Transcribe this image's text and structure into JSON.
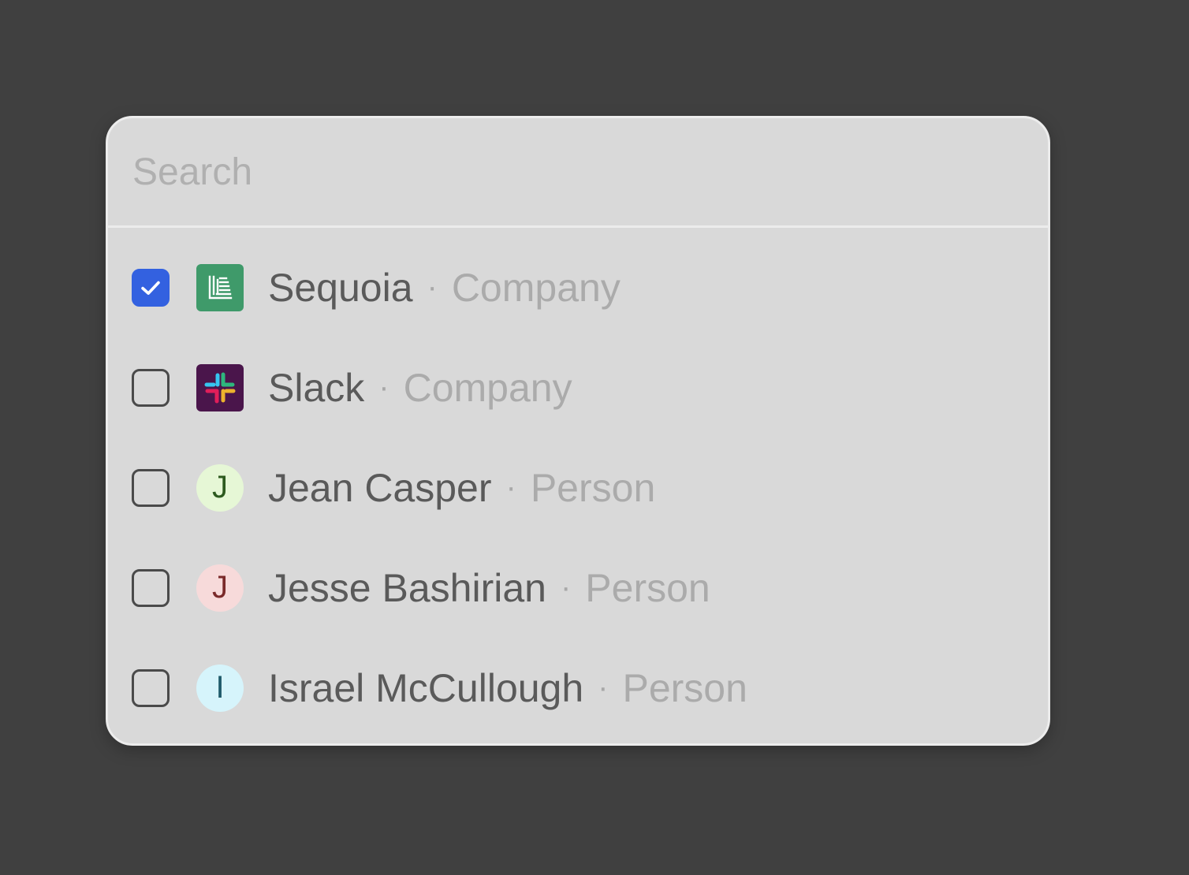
{
  "search": {
    "placeholder": "Search",
    "value": ""
  },
  "items": [
    {
      "name": "Sequoia",
      "separator": "·",
      "type": "Company",
      "checked": true,
      "icon": "sequoia-logo-icon",
      "icon_bg": "#3f9a6a"
    },
    {
      "name": "Slack",
      "separator": "·",
      "type": "Company",
      "checked": false,
      "icon": "slack-logo-icon",
      "icon_bg": "#4a154b"
    },
    {
      "name": "Jean Casper",
      "separator": "·",
      "type": "Person",
      "checked": false,
      "icon": "avatar-initial",
      "initial": "J",
      "avatar_bg": "#e6f7d6",
      "avatar_fg": "#2d5a1f"
    },
    {
      "name": "Jesse Bashirian",
      "separator": "·",
      "type": "Person",
      "checked": false,
      "icon": "avatar-initial",
      "initial": "J",
      "avatar_bg": "#f7dada",
      "avatar_fg": "#7a2a2a"
    },
    {
      "name": "Israel McCullough",
      "separator": "·",
      "type": "Person",
      "checked": false,
      "icon": "avatar-initial",
      "initial": "I",
      "avatar_bg": "#d6f4fb",
      "avatar_fg": "#1f5a6a"
    }
  ],
  "colors": {
    "checkbox_checked": "#3361e0",
    "background": "#404040",
    "panel": "#d9d9d9"
  }
}
